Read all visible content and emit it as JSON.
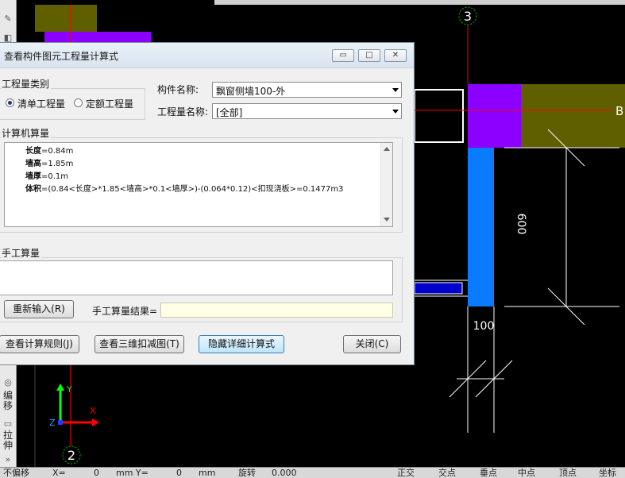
{
  "colors": {
    "canvas_bg": "#000000",
    "purple": "#8b00ff",
    "olive": "#5f5f00",
    "blue": "#0a7bff",
    "axis_red": "#ff0000",
    "axis_green": "#00ff00",
    "dialog_bg": "#f0f0f0"
  },
  "cad": {
    "axis_labels": {
      "axis_3": "3",
      "axis_2": "2",
      "axis_b": "B"
    },
    "dimensions": {
      "height_600": "600",
      "width_100": "100"
    },
    "ucs": {
      "x": "X",
      "y": "Y",
      "z": "Z"
    }
  },
  "left_toolbar": {
    "items": [
      {
        "label": "编移",
        "icon": "offset-icon"
      },
      {
        "label": "拉伸",
        "icon": "stretch-icon"
      }
    ]
  },
  "dialog": {
    "title": "查看构件图元工程量计算式",
    "window_buttons": {
      "minimize": "minimize-icon",
      "restore": "restore-icon",
      "close": "close-icon"
    },
    "quantity_type": {
      "group_label": "工程量类别",
      "options": [
        {
          "label": "清单工程量",
          "selected": true
        },
        {
          "label": "定额工程量",
          "selected": false
        }
      ]
    },
    "component_name": {
      "label": "构件名称:",
      "value": "飘窗侧墙100-外"
    },
    "quantity_name": {
      "label": "工程量名称:",
      "value": "[全部]"
    },
    "computer_calc": {
      "group_label": "计算机算量",
      "lines": [
        {
          "key": "长度",
          "expr": "=0.84m"
        },
        {
          "key": "墙高",
          "expr": "=1.85m"
        },
        {
          "key": "墙厚",
          "expr": "=0.1m"
        },
        {
          "key": "体积",
          "expr": "=(0.84<长度>*1.85<墙高>*0.1<墙厚>)-(0.064*0.12)<扣现浇板>=0.1477m3"
        }
      ]
    },
    "manual_calc": {
      "group_label": "手工算量",
      "reenter_button": "重新输入(R)",
      "result_label": "手工算量结果=",
      "result_value": ""
    },
    "buttons": {
      "view_rules": "查看计算规则(J)",
      "view_3d": "查看三维扣减图(T)",
      "hide_detail": "隐藏详细计算式",
      "close": "关闭(C)"
    }
  },
  "status_bar": {
    "no_offset": "不偏移",
    "x_label": "X=",
    "x_value": "0",
    "y_label": "mm Y=",
    "y_value": "0",
    "unit": "mm",
    "rotate_label": "旋转",
    "rotate_value": "0.000",
    "snap_items": [
      "正交",
      "交点",
      "垂点",
      "中点",
      "顶点",
      "坐标"
    ]
  }
}
